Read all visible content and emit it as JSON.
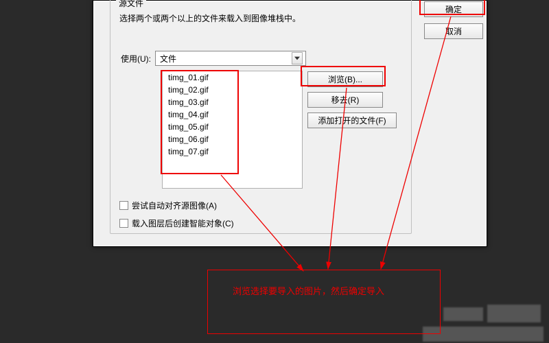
{
  "fieldset_legend": "源文件",
  "description": "选择两个或两个以上的文件来载入到图像堆栈中。",
  "use_label": "使用(U):",
  "use_value": "文件",
  "files": [
    "timg_01.gif",
    "timg_02.gif",
    "timg_03.gif",
    "timg_04.gif",
    "timg_05.gif",
    "timg_06.gif",
    "timg_07.gif"
  ],
  "buttons": {
    "browse": "浏览(B)...",
    "remove": "移去(R)",
    "add_open": "添加打开的文件(F)",
    "ok": "确定",
    "cancel": "取消"
  },
  "checkboxes": {
    "auto_align": "尝试自动对齐源图像(A)",
    "smart_object": "载入图层后创建智能对象(C)"
  },
  "tip": "浏览选择要导入的图片，然后确定导入"
}
